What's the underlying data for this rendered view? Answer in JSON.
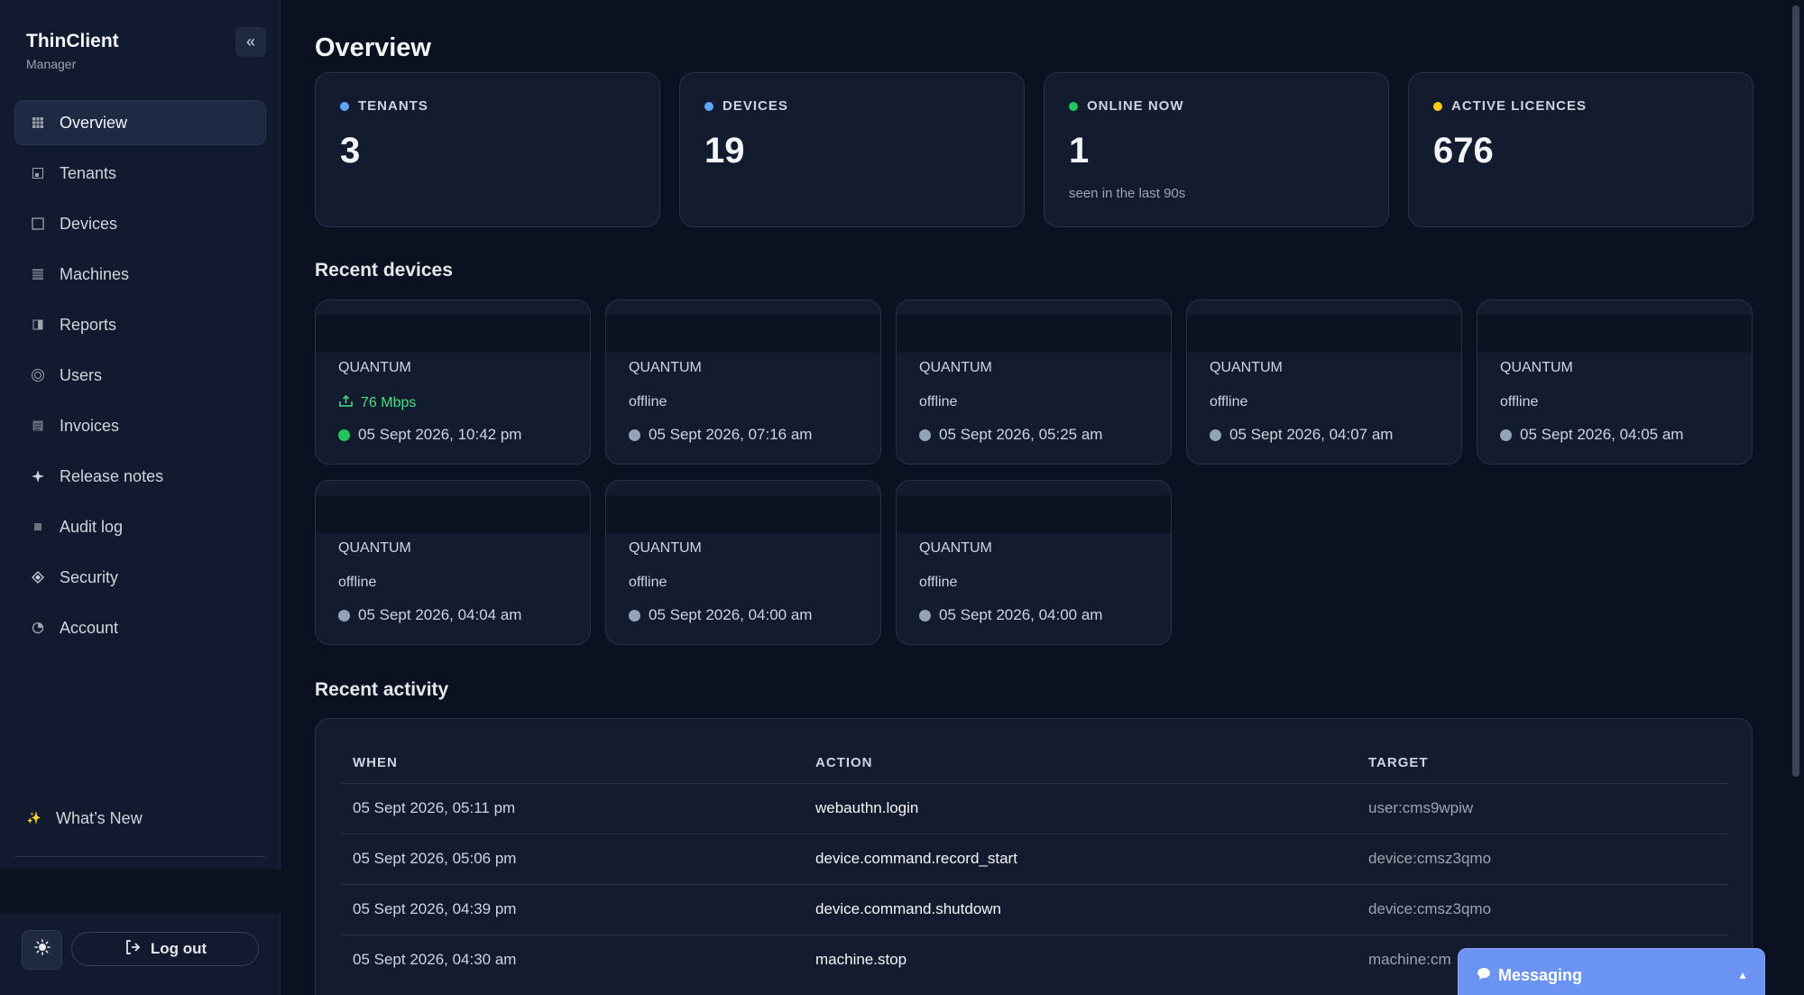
{
  "brand": {
    "title": "ThinClient",
    "subtitle": "Manager"
  },
  "sidebar": {
    "collapse_label": "«",
    "items": [
      {
        "label": "Overview",
        "icon": "grid-icon"
      },
      {
        "label": "Tenants",
        "icon": "building-icon"
      },
      {
        "label": "Devices",
        "icon": "monitor-icon"
      },
      {
        "label": "Machines",
        "icon": "server-icon"
      },
      {
        "label": "Reports",
        "icon": "report-icon"
      },
      {
        "label": "Users",
        "icon": "users-icon"
      },
      {
        "label": "Invoices",
        "icon": "invoice-icon"
      },
      {
        "label": "Release notes",
        "icon": "sparkle-icon"
      },
      {
        "label": "Audit log",
        "icon": "log-icon"
      },
      {
        "label": "Security",
        "icon": "shield-icon"
      },
      {
        "label": "Account",
        "icon": "account-icon"
      }
    ],
    "whats_new": "What’s New",
    "logout_label": "Log out"
  },
  "page": {
    "title": "Overview"
  },
  "stats": [
    {
      "label": "TENANTS",
      "value": "3",
      "sub": "",
      "color": "#60a5fa"
    },
    {
      "label": "DEVICES",
      "value": "19",
      "sub": "",
      "color": "#60a5fa"
    },
    {
      "label": "ONLINE NOW",
      "value": "1",
      "sub": "seen in the last 90s",
      "color": "#22c55e"
    },
    {
      "label": "ACTIVE LICENCES",
      "value": "676",
      "sub": "",
      "color": "#facc15"
    }
  ],
  "recent_devices": {
    "title": "Recent devices",
    "items": [
      {
        "model": "QUANTUM",
        "status": "76 Mbps",
        "online": true,
        "time": "05 Sept 2026, 10:42 pm"
      },
      {
        "model": "QUANTUM",
        "status": "offline",
        "online": false,
        "time": "05 Sept 2026, 07:16 am"
      },
      {
        "model": "QUANTUM",
        "status": "offline",
        "online": false,
        "time": "05 Sept 2026, 05:25 am"
      },
      {
        "model": "QUANTUM",
        "status": "offline",
        "online": false,
        "time": "05 Sept 2026, 04:07 am"
      },
      {
        "model": "QUANTUM",
        "status": "offline",
        "online": false,
        "time": "05 Sept 2026, 04:05 am"
      },
      {
        "model": "QUANTUM",
        "status": "offline",
        "online": false,
        "time": "05 Sept 2026, 04:04 am"
      },
      {
        "model": "QUANTUM",
        "status": "offline",
        "online": false,
        "time": "05 Sept 2026, 04:00 am"
      },
      {
        "model": "QUANTUM",
        "status": "offline",
        "online": false,
        "time": "05 Sept 2026, 04:00 am"
      }
    ]
  },
  "recent_activity": {
    "title": "Recent activity",
    "columns": [
      "WHEN",
      "ACTION",
      "TARGET"
    ],
    "rows": [
      {
        "when": "05 Sept 2026, 05:11 pm",
        "action": "webauthn.login",
        "target": "user:cms9wpiw"
      },
      {
        "when": "05 Sept 2026, 05:06 pm",
        "action": "device.command.record_start",
        "target": "device:cmsz3qmo"
      },
      {
        "when": "05 Sept 2026, 04:39 pm",
        "action": "device.command.shutdown",
        "target": "device:cmsz3qmo"
      },
      {
        "when": "05 Sept 2026, 04:30 am",
        "action": "machine.stop",
        "target": "machine:cm"
      }
    ]
  },
  "messaging": {
    "label": "Messaging"
  }
}
